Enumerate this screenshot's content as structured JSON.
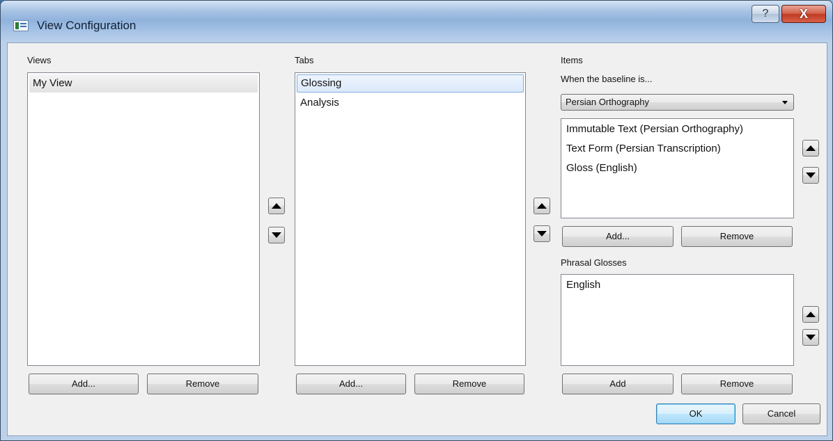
{
  "window": {
    "title": "View Configuration",
    "help_glyph": "?",
    "close_glyph": "X"
  },
  "views": {
    "label": "Views",
    "items": [
      "My View"
    ],
    "selected": "My View",
    "add_label": "Add...",
    "remove_label": "Remove"
  },
  "tabs": {
    "label": "Tabs",
    "items": [
      "Glossing",
      "Analysis"
    ],
    "selected": "Glossing",
    "add_label": "Add...",
    "remove_label": "Remove"
  },
  "items": {
    "label": "Items",
    "baseline_label": "When the baseline is...",
    "baseline_value": "Persian Orthography",
    "list": [
      "Immutable Text (Persian Orthography)",
      "Text Form (Persian Transcription)",
      "Gloss (English)"
    ],
    "add_label": "Add...",
    "remove_label": "Remove"
  },
  "phrasal_glosses": {
    "label": "Phrasal Glosses",
    "list": [
      "English"
    ],
    "add_label": "Add",
    "remove_label": "Remove"
  },
  "footer": {
    "ok_label": "OK",
    "cancel_label": "Cancel"
  },
  "icons": {
    "app": "window-app-icon",
    "move_up": "triangle-up-icon",
    "move_down": "triangle-down-icon",
    "dropdown": "chevron-down-icon"
  }
}
